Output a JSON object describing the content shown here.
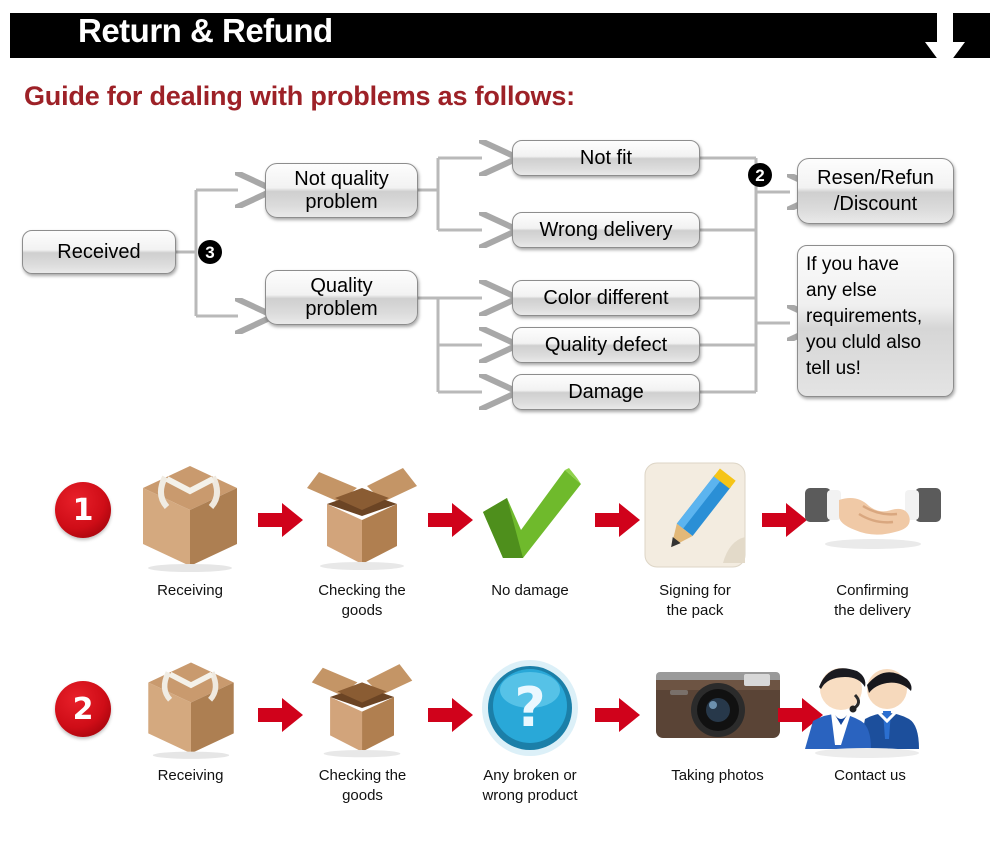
{
  "header": {
    "title": "Return & Refund",
    "arrow_icon": "down-arrow-icon",
    "bar_color": "#000000"
  },
  "guide": {
    "heading": "Guide for dealing with problems as follows:",
    "heading_color": "#9d2127"
  },
  "flowchart": {
    "start": "Received",
    "badge_start": "3",
    "badge_merge": "2",
    "branches": [
      {
        "label": "Not quality\nproblem",
        "line1": "Not quality",
        "line2": "problem"
      },
      {
        "label": "Quality\nproblem",
        "line1": "Quality",
        "line2": "problem"
      }
    ],
    "issues": [
      "Not fit",
      "Wrong delivery",
      "Color different",
      "Quality defect",
      "Damage"
    ],
    "outcomes": {
      "resolution_line1": "Resen/Refun",
      "resolution_line2": "/Discount",
      "note": "If you have any else requirements, you cluld also tell us!",
      "note_lines": [
        "If you have",
        "any else",
        "requirements,",
        "you cluld also",
        "tell us!"
      ]
    }
  },
  "process": {
    "arrow_color": "#d0021b",
    "rows": [
      {
        "number": "1",
        "steps": [
          {
            "icon": "sealed-box-icon",
            "label_line1": "Receiving",
            "label_line2": ""
          },
          {
            "icon": "open-box-icon",
            "label_line1": "Checking the",
            "label_line2": "goods"
          },
          {
            "icon": "green-check-icon",
            "label_line1": "No damage",
            "label_line2": ""
          },
          {
            "icon": "pencil-sign-icon",
            "label_line1": "Signing for",
            "label_line2": "the pack"
          },
          {
            "icon": "handshake-icon",
            "label_line1": "Confirming",
            "label_line2": "the delivery"
          }
        ]
      },
      {
        "number": "2",
        "steps": [
          {
            "icon": "sealed-box-icon",
            "label_line1": "Receiving",
            "label_line2": ""
          },
          {
            "icon": "open-box-icon",
            "label_line1": "Checking the",
            "label_line2": "goods"
          },
          {
            "icon": "question-mark-icon",
            "label_line1": "Any broken or",
            "label_line2": "wrong product"
          },
          {
            "icon": "camera-icon",
            "label_line1": "Taking photos",
            "label_line2": ""
          },
          {
            "icon": "support-agents-icon",
            "label_line1": "Contact us",
            "label_line2": ""
          }
        ]
      }
    ]
  }
}
